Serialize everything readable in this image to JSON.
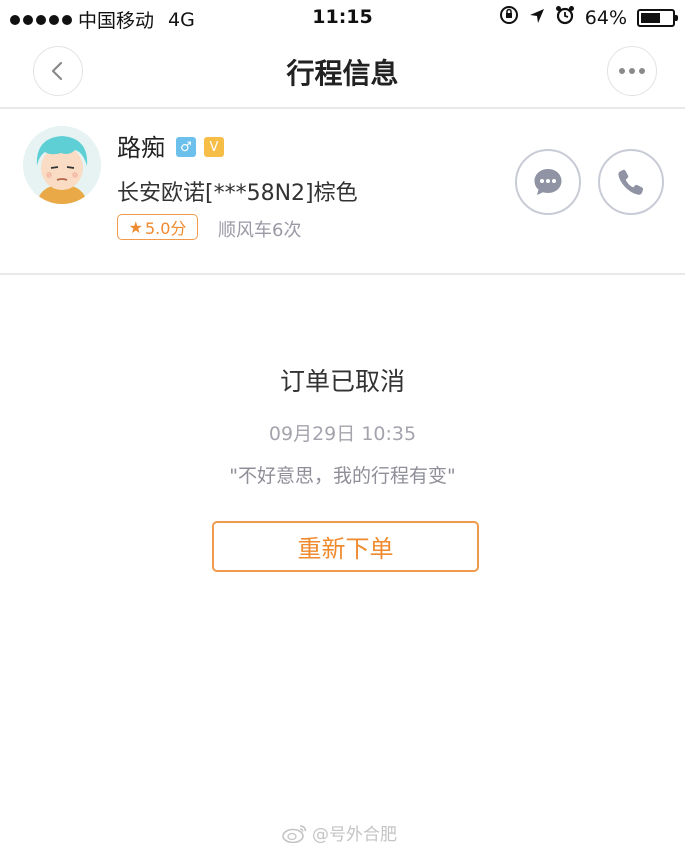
{
  "status_bar": {
    "carrier": "中国移动",
    "network": "4G",
    "time": "11:15",
    "battery_percent": "64%",
    "battery_level": 0.64
  },
  "nav": {
    "title": "行程信息",
    "back_icon": "chevron-left-icon",
    "more_icon": "ellipsis-icon"
  },
  "driver": {
    "name": "路痴",
    "gender_badge": "♂",
    "verified_badge": "V",
    "car": "长安欧诺[***58N2]棕色",
    "rating": "5.0分",
    "ride_count": "顺风车6次",
    "message_icon": "chat-bubble-icon",
    "call_icon": "phone-icon"
  },
  "order": {
    "status": "订单已取消",
    "time": "09月29日 10:35",
    "reason": "\"不好意思，我的行程有变\"",
    "reorder_label": "重新下单"
  },
  "watermark": {
    "text": "@号外合肥"
  },
  "colors": {
    "accent_orange": "#ef8a2f",
    "divider": "#e9e9e9",
    "badge_blue": "#6cc0ec",
    "badge_yellow": "#f6be46"
  }
}
